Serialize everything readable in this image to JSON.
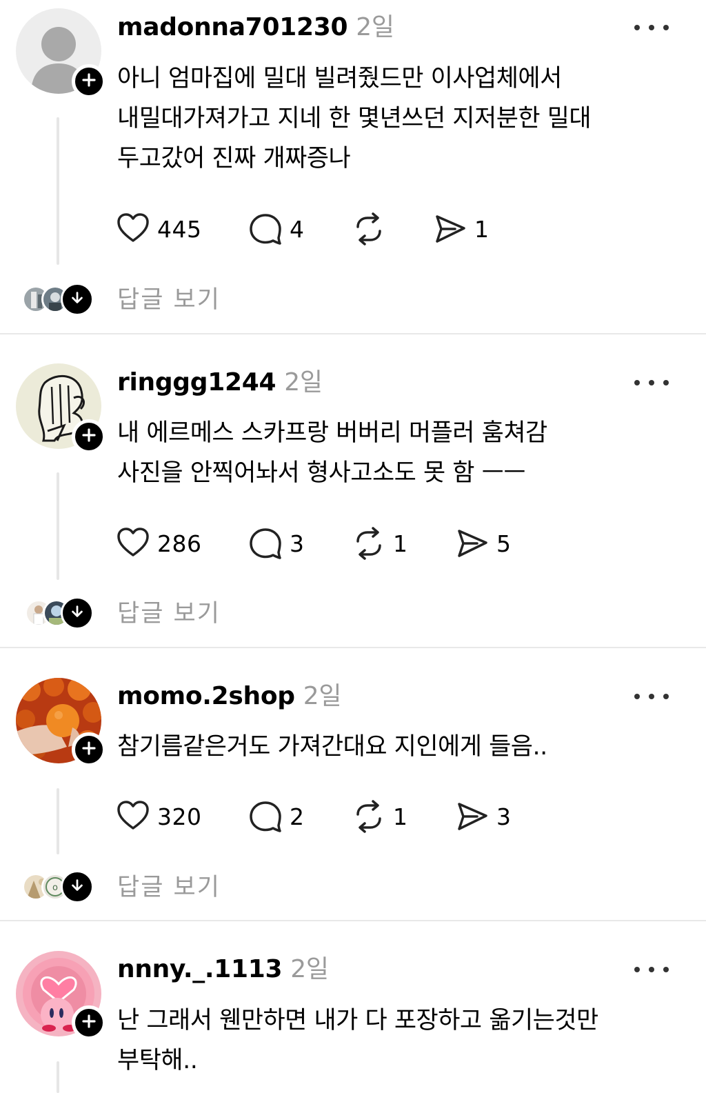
{
  "posts": [
    {
      "username": "madonna701230",
      "time": "2일",
      "text": "아니 엄마집에 밀대 빌려줬드만 이사업체에서\n내밀대가져가고 지네 한 몇년쓰던 지저분한 밀대\n두고갔어 진짜 개짜증나",
      "likes": "445",
      "comments": "4",
      "reposts": "",
      "shares": "1",
      "view_replies": "답글 보기"
    },
    {
      "username": "ringgg1244",
      "time": "2일",
      "text": "내 에르메스 스카프랑 버버리 머플러 훔쳐감\n사진을 안찍어놔서 형사고소도 못 함 ㅡㅡ",
      "likes": "286",
      "comments": "3",
      "reposts": "1",
      "shares": "5",
      "view_replies": "답글 보기"
    },
    {
      "username": "momo.2shop",
      "time": "2일",
      "text": "참기름같은거도 가져간대요 지인에게 들음..",
      "likes": "320",
      "comments": "2",
      "reposts": "1",
      "shares": "3",
      "view_replies": "답글 보기"
    },
    {
      "username": "nnny._.1113",
      "time": "2일",
      "text": "난 그래서 웬만하면 내가 다 포장하고 옮기는것만\n부탁해..",
      "view_replies": ""
    }
  ],
  "icons": {
    "like": "heart-icon",
    "comment": "comment-bubble-icon",
    "repost": "repost-icon",
    "share": "send-icon",
    "follow": "plus-icon",
    "more": "more-dots-icon",
    "expand": "arrow-down-icon"
  },
  "colors": {
    "text": "#000000",
    "muted": "#9a9a9a",
    "divider": "#e8e8e8",
    "thread_line": "#e6e6e6"
  }
}
